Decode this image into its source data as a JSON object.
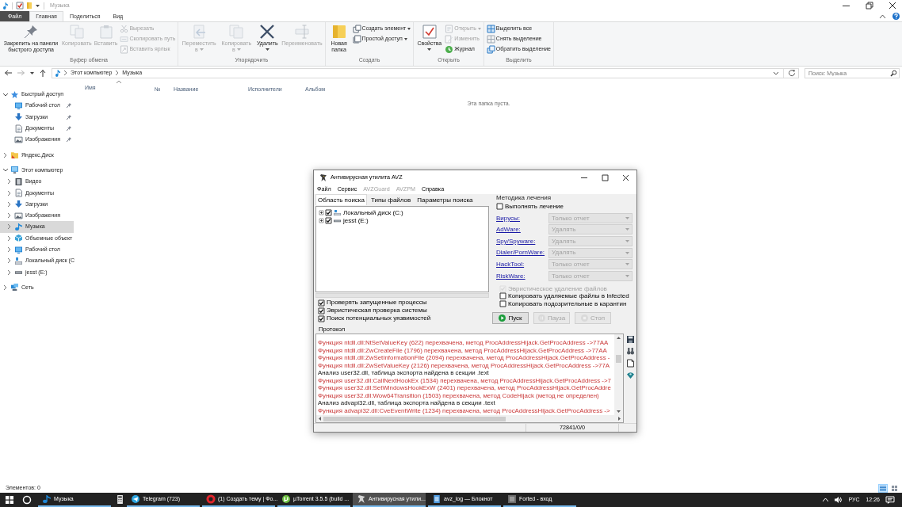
{
  "explorer": {
    "title": "Музыка",
    "ribbon_tabs": [
      {
        "label": "Файл",
        "kind": "file",
        "selected": false
      },
      {
        "label": "Главная",
        "kind": "tab",
        "selected": true
      },
      {
        "label": "Поделиться",
        "kind": "tab",
        "selected": false
      },
      {
        "label": "Вид",
        "kind": "tab",
        "selected": false
      }
    ],
    "ribbon_groups": [
      {
        "label": "Буфер обмена",
        "large": [
          {
            "label": "Закрепить на панели быстрого доступа",
            "disabled": false,
            "dropdown": false
          },
          {
            "label": "Копировать",
            "disabled": true,
            "dropdown": false
          },
          {
            "label": "Вставить",
            "disabled": true,
            "dropdown": false
          }
        ],
        "small": [
          {
            "label": "Вырезать",
            "disabled": true,
            "dropdown": false
          },
          {
            "label": "Скопировать путь",
            "disabled": true,
            "dropdown": false
          },
          {
            "label": "Вставить ярлык",
            "disabled": true,
            "dropdown": false
          }
        ]
      },
      {
        "label": "Упорядочить",
        "large": [
          {
            "label": "Переместить в",
            "disabled": true,
            "dropdown": true
          },
          {
            "label": "Копировать в",
            "disabled": true,
            "dropdown": true
          },
          {
            "label": "Удалить",
            "disabled": false,
            "dropdown": true
          },
          {
            "label": "Переименовать",
            "disabled": true,
            "dropdown": false
          }
        ]
      },
      {
        "label": "Создать",
        "large": [
          {
            "label": "Новая папка",
            "disabled": false,
            "dropdown": false
          }
        ],
        "small": [
          {
            "label": "Создать элемент",
            "disabled": false,
            "dropdown": true
          },
          {
            "label": "Простой доступ",
            "disabled": false,
            "dropdown": true
          }
        ]
      },
      {
        "label": "Открыть",
        "large": [
          {
            "label": "Свойства",
            "disabled": false,
            "dropdown": true
          }
        ],
        "small": [
          {
            "label": "Открыть",
            "disabled": true,
            "dropdown": true
          },
          {
            "label": "Изменить",
            "disabled": true,
            "dropdown": false
          },
          {
            "label": "Журнал",
            "disabled": false,
            "dropdown": false
          }
        ]
      },
      {
        "label": "Выделить",
        "small": [
          {
            "label": "Выделить все",
            "disabled": false,
            "dropdown": false
          },
          {
            "label": "Снять выделение",
            "disabled": false,
            "dropdown": false
          },
          {
            "label": "Обратить выделение",
            "disabled": false,
            "dropdown": false
          }
        ]
      }
    ],
    "history_buttons": [
      {
        "disabled": false
      },
      {
        "disabled": true
      }
    ],
    "address": {
      "path": [
        "Этот компьютер",
        "Музыка"
      ]
    },
    "search": {
      "placeholder": "Поиск: Музыка"
    },
    "nav_tree": [
      {
        "label": "Быстрый доступ",
        "expanded": true,
        "selected": false,
        "children": [
          {
            "label": "Рабочий стол",
            "pinned": true,
            "selected": false
          },
          {
            "label": "Загрузки",
            "pinned": true,
            "selected": false
          },
          {
            "label": "Документы",
            "pinned": true,
            "selected": false
          },
          {
            "label": "Изображения",
            "pinned": true,
            "selected": false
          }
        ]
      },
      {
        "label": "Яндекс.Диск",
        "expanded": false,
        "selected": false
      },
      {
        "label": "Этот компьютер",
        "expanded": true,
        "selected": false,
        "children": [
          {
            "label": "Видео",
            "expanded": false,
            "selected": false
          },
          {
            "label": "Документы",
            "expanded": false,
            "selected": false
          },
          {
            "label": "Загрузки",
            "expanded": false,
            "selected": false
          },
          {
            "label": "Изображения",
            "expanded": false,
            "selected": false
          },
          {
            "label": "Музыка",
            "expanded": false,
            "selected": true
          },
          {
            "label": "Объемные объект",
            "expanded": false,
            "selected": false
          },
          {
            "label": "Рабочий стол",
            "expanded": false,
            "selected": false
          },
          {
            "label": "Локальный диск (C",
            "expanded": false,
            "selected": false
          },
          {
            "label": "jesst (E:)",
            "expanded": false,
            "selected": false
          }
        ]
      },
      {
        "label": "Сеть",
        "expanded": false,
        "selected": false
      }
    ],
    "columns": [
      {
        "label": "Имя",
        "sorted": true
      },
      {
        "label": "№",
        "sorted": false
      },
      {
        "label": "Название",
        "sorted": false
      },
      {
        "label": "Исполнители",
        "sorted": false
      },
      {
        "label": "Альбом",
        "sorted": false
      }
    ],
    "empty_message": "Эта папка пуста.",
    "status": "Элементов: 0",
    "view_buttons": [
      {
        "selected": true
      },
      {
        "selected": false
      }
    ]
  },
  "avz_window": {
    "title": "Антивирусная утилита AVZ",
    "menu": [
      {
        "label": "Файл",
        "disabled": false
      },
      {
        "label": "Сервис",
        "disabled": false
      },
      {
        "label": "AVZGuard",
        "disabled": true
      },
      {
        "label": "AVZPM",
        "disabled": true
      },
      {
        "label": "Справка",
        "disabled": false
      }
    ],
    "tabs": [
      {
        "label": "Область поиска",
        "selected": true
      },
      {
        "label": "Типы файлов",
        "selected": false
      },
      {
        "label": "Параметры поиска",
        "selected": false
      }
    ],
    "drives": [
      {
        "label": "Локальный диск (C:)",
        "checked": true
      },
      {
        "label": "jesst (E:)",
        "checked": true
      }
    ],
    "scan_options": [
      {
        "label": "Проверять запущенные процессы",
        "checked": true
      },
      {
        "label": "Эвристическая проверка системы",
        "checked": true
      },
      {
        "label": "Поиск потенциальных уязвимостей",
        "checked": true
      }
    ],
    "treatment": {
      "title": "Методика лечения",
      "enable": {
        "label": "Выполнять лечение",
        "checked": false
      },
      "rows": [
        {
          "label": "Вирусы:",
          "value": "Только отчет",
          "disabled": true
        },
        {
          "label": "AdWare:",
          "value": "Удалять",
          "disabled": true
        },
        {
          "label": "Spy/Spyware:",
          "value": "Удалять",
          "disabled": true
        },
        {
          "label": "Dialer/PornWare:",
          "value": "Удалять",
          "disabled": true
        },
        {
          "label": "HackTool:",
          "value": "Только отчет",
          "disabled": true
        },
        {
          "label": "RiskWare:",
          "value": "Только отчет",
          "disabled": true
        }
      ],
      "options": [
        {
          "label": "Эвристическое удаление файлов",
          "checked": true,
          "disabled": true
        },
        {
          "label": "Копировать удаляемые файлы в Infected",
          "checked": false,
          "disabled": false
        },
        {
          "label": "Копировать подозрительные в карантин",
          "checked": false,
          "disabled": false
        }
      ]
    },
    "buttons": [
      {
        "label": "Пуск",
        "disabled": false
      },
      {
        "label": "Пауза",
        "disabled": true
      },
      {
        "label": "Стоп",
        "disabled": true
      }
    ],
    "log_title": "Протокол",
    "log": [
      {
        "kind": "hook",
        "text": "Функция ntdll.dll:NtSetValueKey (622) перехвачена, метод ProcAddressHijack.GetProcAddress ->77AA"
      },
      {
        "kind": "hook",
        "text": "Функция ntdll.dll:ZwCreateFile (1796) перехвачена, метод ProcAddressHijack.GetProcAddress ->77AA"
      },
      {
        "kind": "hook",
        "text": "Функция ntdll.dll:ZwSetInformationFile (2094) перехвачена, метод ProcAddressHijack.GetProcAddress -"
      },
      {
        "kind": "hook",
        "text": "Функция ntdll.dll:ZwSetValueKey (2126) перехвачена, метод ProcAddressHijack.GetProcAddress ->77A"
      },
      {
        "kind": "info",
        "text": "Анализ user32.dll, таблица экспорта найдена в секции .text"
      },
      {
        "kind": "hook",
        "text": "Функция user32.dll:CallNextHookEx (1534) перехвачена, метод ProcAddressHijack.GetProcAddress ->7"
      },
      {
        "kind": "hook",
        "text": "Функция user32.dll:SetWindowsHookExW (2401) перехвачена, метод ProcAddressHijack.GetProcAddre"
      },
      {
        "kind": "hook",
        "text": "Функция user32.dll:Wow64Transition (1503) перехвачена, метод CodeHijack (метод не определен)"
      },
      {
        "kind": "info",
        "text": "Анализ advapi32.dll, таблица экспорта найдена в секции .text"
      },
      {
        "kind": "hook",
        "text": "Функция advapi32.dll:CveEventWrite (1234) перехвачена, метод ProcAddressHijack.GetProcAddress ->"
      }
    ],
    "status": "72841/0/0"
  },
  "taskbar": {
    "items": [
      {
        "kind": "window",
        "label": "Музыка",
        "selected": false
      },
      {
        "kind": "pinned",
        "selected": false
      },
      {
        "kind": "window",
        "label": "Telegram (723)",
        "selected": false
      },
      {
        "kind": "window",
        "label": "(1) Создать тему | Фо...",
        "selected": false
      },
      {
        "kind": "window",
        "label": "µTorrent 3.5.5  (build ...",
        "selected": false
      },
      {
        "kind": "window",
        "label": "Антивирусная утили...",
        "selected": true
      },
      {
        "kind": "window",
        "label": "avz_log — Блокнот",
        "selected": false
      },
      {
        "kind": "window",
        "label": "Forted - вход",
        "selected": false
      }
    ],
    "language": "РУС",
    "time": "12:26"
  }
}
